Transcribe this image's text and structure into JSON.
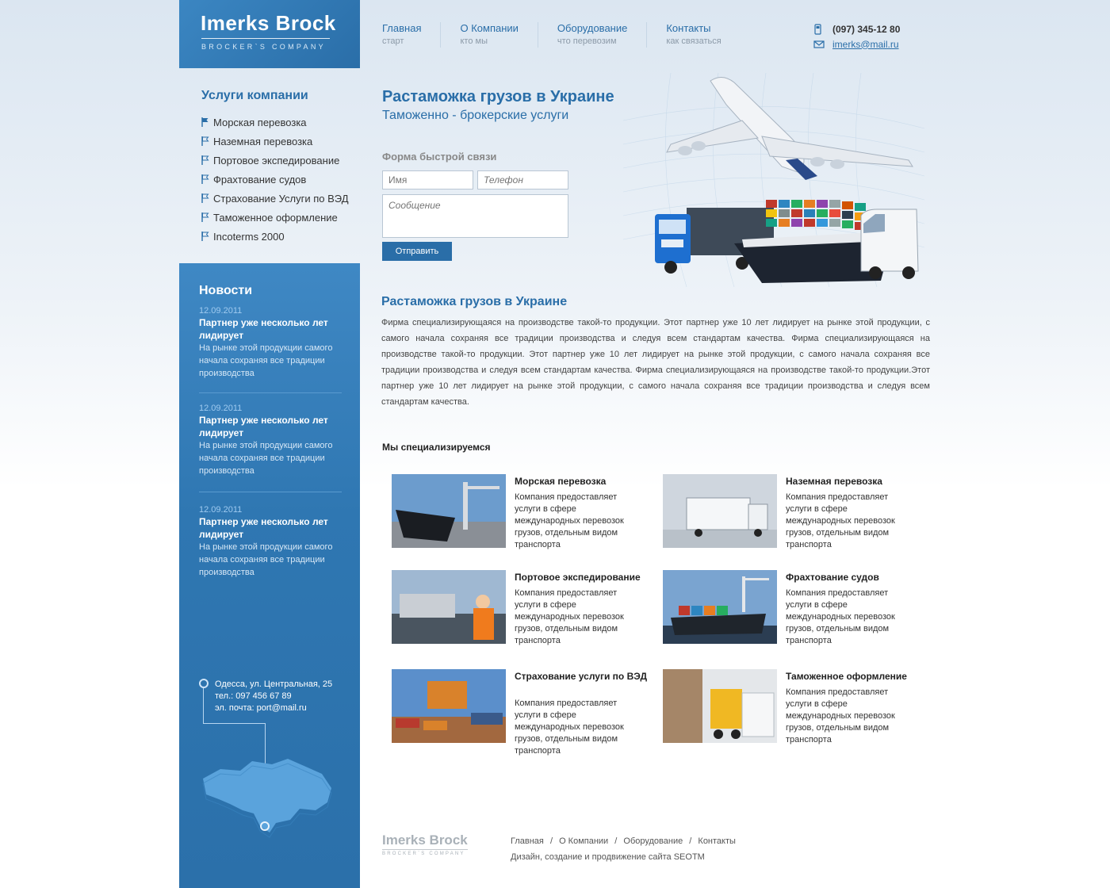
{
  "logo": {
    "title": "Imerks Brock",
    "subtitle": "BROCKER`S COMPANY"
  },
  "nav": [
    {
      "label": "Главная",
      "sub": "старт"
    },
    {
      "label": "О Компании",
      "sub": "кто мы"
    },
    {
      "label": "Оборудование",
      "sub": "что перевозим"
    },
    {
      "label": "Контакты",
      "sub": "как связаться"
    }
  ],
  "contact": {
    "phone": "(097) 345-12 80",
    "email": "imerks@mail.ru"
  },
  "services": {
    "title": "Услуги компании",
    "items": [
      "Морская перевозка",
      "Наземная перевозка",
      "Портовое экспедирование",
      "Фрахтование судов",
      "Страхование Услуги по ВЭД",
      "Таможенное оформление",
      "Incoterms 2000"
    ]
  },
  "news": {
    "title": "Новости",
    "items": [
      {
        "date": "12.09.2011",
        "headline": "Партнер уже несколько лет лидирует",
        "text": "На рынке этой продукции самого начала сохраняя все традиции производства"
      },
      {
        "date": "12.09.2011",
        "headline": "Партнер уже несколько лет лидирует",
        "text": "На рынке этой продукции самого начала сохраняя все традиции производства"
      },
      {
        "date": "12.09.2011",
        "headline": "Партнер уже несколько лет лидирует",
        "text": "На рынке этой продукции самого начала сохраняя все традиции производства"
      }
    ]
  },
  "address": {
    "line1": "Одесса, ул. Центральная, 25",
    "line2": "тел.: 097 456 67 89",
    "line3": "эл. почта: port@mail.ru"
  },
  "hero": {
    "title": "Растаможка грузов в Украине",
    "subtitle": "Таможенно - брокерские услуги"
  },
  "form": {
    "title": "Форма быстрой связи",
    "name_placeholder": "Имя",
    "phone_placeholder": "Телефон",
    "message_placeholder": "Сообщение",
    "submit": "Отправить"
  },
  "about": {
    "title": "Растаможка грузов в Украине",
    "text": "Фирма специализирующаяся на производстве такой-то продукции. Этот партнер уже 10 лет лидирует на рынке этой продукции, с самого начала сохраняя все традиции производства и следуя всем стандартам качества. Фирма специализирующаяся на производстве такой-то продукции. Этот партнер уже 10 лет лидирует на рынке этой продукции, с самого начала сохраняя все традиции производства и следуя всем стандартам качества. Фирма специализирующаяся на производстве такой-то продукции.Этот партнер уже 10 лет лидирует на рынке этой продукции, с самого начала сохраняя все традиции производства и следуя всем стандартам качества."
  },
  "specialize": {
    "title": "Мы специализируемся",
    "items": [
      {
        "name": "Морская перевозка",
        "desc": "Компания предоставляет услуги в сфере международных перевозок грузов, отдельным видом транспорта"
      },
      {
        "name": "Наземная перевозка",
        "desc": "Компания предоставляет услуги в сфере международных перевозок грузов, отдельным видом транспорта"
      },
      {
        "name": "Портовое экспедирование",
        "desc": "Компания предоставляет услуги в сфере международных перевозок грузов, отдельным видом транспорта"
      },
      {
        "name": "Фрахтование судов",
        "desc": "Компания предоставляет услуги в сфере международных перевозок грузов, отдельным видом транспорта"
      },
      {
        "name": "Страхование услуги по ВЭД",
        "desc": "Компания предоставляет услуги в сфере международных перевозок грузов, отдельным видом транспорта"
      },
      {
        "name": "Таможенное оформление",
        "desc": "Компания предоставляет услуги в сфере международных перевозок грузов, отдельным видом транспорта"
      }
    ]
  },
  "footer": {
    "links": [
      "Главная",
      "О Компании",
      "Оборудование",
      "Контакты"
    ],
    "separator": "/",
    "credit": "Дизайн, создание и продвижение сайта SEOTM"
  },
  "colors": {
    "brand": "#2a6ea8",
    "sidebar": "#2f77b2"
  }
}
